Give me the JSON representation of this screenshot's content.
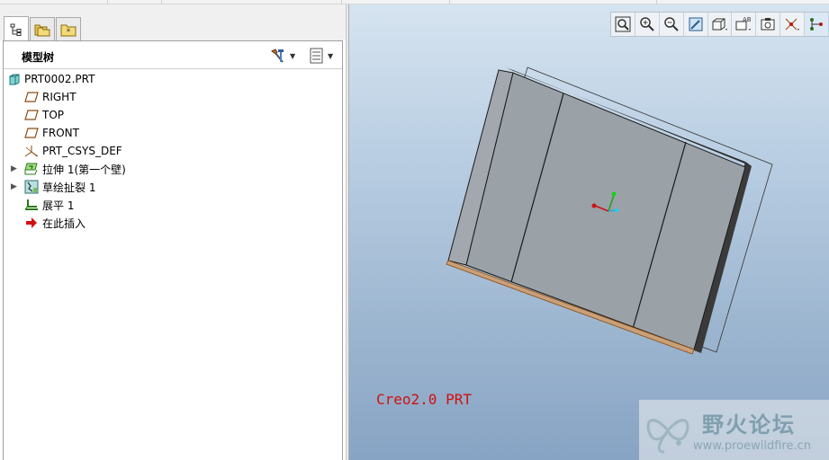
{
  "panel": {
    "tabs": [
      {
        "name": "model-tree-tab",
        "icon": "tree-icon",
        "active": true
      },
      {
        "name": "folder-browser-tab",
        "icon": "folders-icon",
        "active": false
      },
      {
        "name": "favorites-tab",
        "icon": "favorites-folder-icon",
        "active": false
      }
    ],
    "title": "模型树",
    "tree": [
      {
        "label": "PRT0002.PRT",
        "icon": "part-icon",
        "expandable": false
      },
      {
        "label": "RIGHT",
        "icon": "datum-plane-icon",
        "expandable": false
      },
      {
        "label": "TOP",
        "icon": "datum-plane-icon",
        "expandable": false
      },
      {
        "label": "FRONT",
        "icon": "datum-plane-icon",
        "expandable": false
      },
      {
        "label": "PRT_CSYS_DEF",
        "icon": "csys-icon",
        "expandable": false
      },
      {
        "label": "拉伸 1(第一个壁)",
        "icon": "sheetmetal-wall-icon",
        "expandable": true
      },
      {
        "label": "草绘扯裂 1",
        "icon": "sketched-rip-icon",
        "expandable": true
      },
      {
        "label": "展平 1",
        "icon": "unbend-icon",
        "expandable": false
      },
      {
        "label": "在此插入",
        "icon": "insert-here-arrow-icon",
        "expandable": false
      }
    ]
  },
  "viewport": {
    "toolbar": [
      {
        "name": "refit-button",
        "icon": "zoom-fit-icon"
      },
      {
        "name": "zoom-in-button",
        "icon": "zoom-in-icon"
      },
      {
        "name": "zoom-out-button",
        "icon": "zoom-out-icon"
      },
      {
        "name": "repaint-button",
        "icon": "repaint-icon"
      },
      {
        "name": "display-style-button",
        "icon": "display-style-icon"
      },
      {
        "name": "saved-views-button",
        "icon": "saved-orientations-icon"
      },
      {
        "name": "view-manager-button",
        "icon": "view-manager-icon"
      },
      {
        "name": "datum-display-button",
        "icon": "datum-display-icon"
      },
      {
        "name": "annotation-display-button",
        "icon": "annotation-display-icon"
      }
    ],
    "caption": "Creo2.0 PRT",
    "watermark": {
      "title": "野火论坛",
      "url": "www.proewildfire.cn"
    }
  },
  "colors": {
    "caption": "#d01010",
    "model_face": "#9aa1a7",
    "model_edge": "#1a1a1a",
    "viewport_top": "#d6e4f0",
    "viewport_bottom": "#88a4c4"
  }
}
